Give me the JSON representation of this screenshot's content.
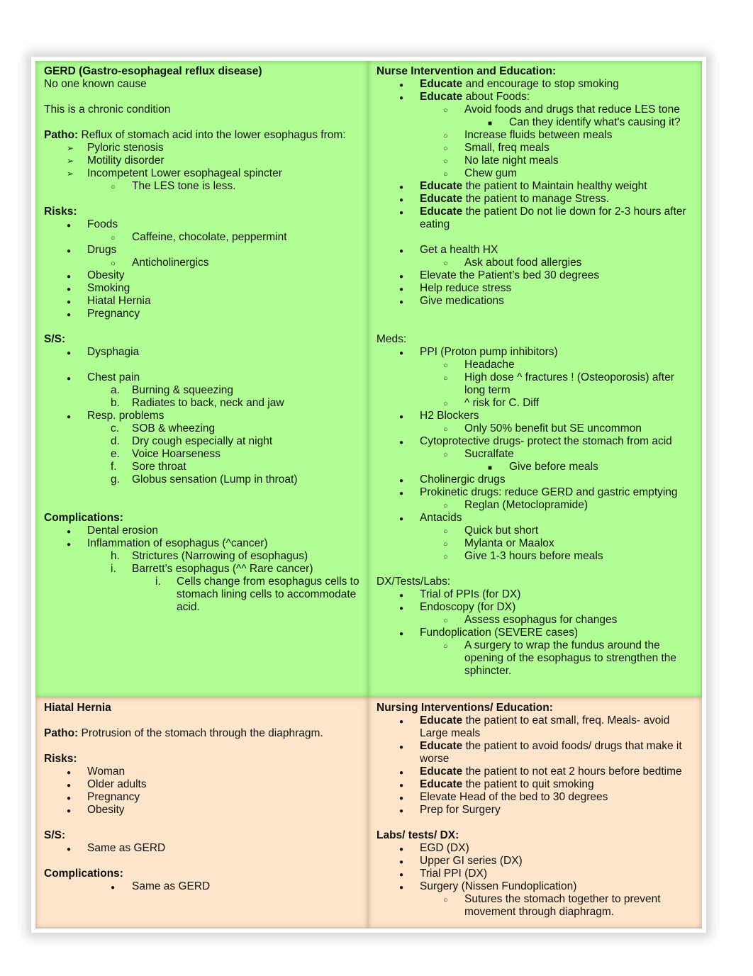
{
  "gerd": {
    "title": "GERD (Gastro-esophageal reflux disease)",
    "cause": "No one known cause",
    "chronic": "This is a chronic condition",
    "patho_label": "Patho:",
    "patho_text": " Reflux of stomach acid into the lower esophagus from:",
    "patho_items": [
      "Pyloric stenosis",
      "Motility disorder",
      "Incompetent Lower esophageal spincter"
    ],
    "patho_sub": "The LES tone is less.",
    "risks_label": "Risks:",
    "risks": {
      "foods": "Foods",
      "foods_sub": "Caffeine, chocolate, peppermint",
      "drugs": "Drugs",
      "drugs_sub": "Anticholinergics",
      "others": [
        "Obesity",
        "Smoking",
        "Hiatal Hernia",
        "Pregnancy"
      ]
    },
    "ss_label": "S/S:",
    "ss": {
      "dysphagia": "Dysphagia",
      "chest_pain": "Chest pain",
      "chest_sub": [
        {
          "marker": "a.",
          "text": "Burning & squeezing"
        },
        {
          "marker": "b.",
          "text": "Radiates to back, neck and jaw"
        }
      ],
      "resp": "Resp. problems",
      "resp_sub": [
        {
          "marker": "c.",
          "text": "SOB & wheezing"
        },
        {
          "marker": "d.",
          "text": "Dry cough especially at night"
        },
        {
          "marker": "e.",
          "text": "Voice Hoarseness"
        },
        {
          "marker": "f.",
          "text": "Sore throat"
        },
        {
          "marker": "g.",
          "text": "Globus sensation (Lump in throat)"
        }
      ]
    },
    "comp_label": "Complications:",
    "comp": {
      "items": [
        "Dental erosion",
        "Inflammation of esophagus (^cancer)"
      ],
      "sub": [
        {
          "marker": "h.",
          "text": "Strictures (Narrowing of esophagus)"
        },
        {
          "marker": "i.",
          "text": "Barrett’s esophagus (^^ Rare cancer)"
        }
      ],
      "subsub_marker": "i.",
      "subsub_text": "Cells change from esophagus cells to stomach lining cells to accommodate acid."
    }
  },
  "nurse": {
    "title": "Nurse Intervention and Education:",
    "educate": "Educate",
    "edu1": " and encourage to stop smoking",
    "edu2": " about Foods:",
    "food_sub1": "Avoid foods and drugs that reduce LES tone",
    "food_subsub": "Can they identify what's causing it?",
    "food_subs": [
      "Increase fluids between meals",
      "Small, freq meals",
      "No late night meals",
      "Chew gum"
    ],
    "edu3": " the patient to Maintain healthy weight",
    "edu4": " the patient to manage Stress.",
    "edu5": " the patient Do not lie down for 2-3 hours after eating",
    "hx": "Get a health HX",
    "hx_sub": "Ask about food allergies",
    "others": [
      "Elevate the Patient’s bed 30 degrees",
      "Help reduce stress",
      "Give medications"
    ],
    "meds_label": "Meds:",
    "ppi": "PPI (Proton pump inhibitors)",
    "ppi_sub": [
      "Headache",
      "High dose ^ fractures ! (Osteoporosis) after long term",
      "^ risk for C. Diff"
    ],
    "h2": "H2 Blockers",
    "h2_sub": "Only 50% benefit but SE uncommon",
    "cyto": "Cytoprotective drugs- protect the stomach from acid",
    "cyto_sub": "Sucralfate",
    "cyto_subsub": "Give before meals",
    "chol": "Cholinergic drugs",
    "prok": "Prokinetic drugs: reduce GERD and gastric emptying",
    "prok_sub": "Reglan (Metoclopramide)",
    "antacids": "Antacids",
    "antacids_sub": [
      "Quick but short",
      "Mylanta or Maalox",
      "Give 1-3 hours before meals"
    ],
    "dx_label": "DX/Tests/Labs:",
    "dx1": "Trial of PPIs (for DX)",
    "dx2": "Endoscopy (for DX)",
    "dx2_sub": "Assess esophagus for changes",
    "dx3": "Fundoplication (SEVERE cases)",
    "dx3_sub": "A surgery to wrap the fundus around the opening of the esophagus to strengthen the sphincter."
  },
  "hiatal": {
    "title": "Hiatal Hernia",
    "patho_label": "Patho:",
    "patho_text": " Protrusion of the stomach through the diaphragm.",
    "risks_label": "Risks:",
    "risks": [
      "Woman",
      "Older adults",
      "Pregnancy",
      "Obesity"
    ],
    "ss_label": "S/S:",
    "ss": "Same as GERD",
    "comp_label": "Complications:",
    "comp": "Same as GERD"
  },
  "hiatal_nursing": {
    "title": "Nursing Interventions/ Education:",
    "educate": "Educate",
    "edu1": " the patient to eat small, freq. Meals- avoid Large meals",
    "edu2": " the patient to avoid foods/ drugs that make it worse",
    "edu3": " the patient to not eat 2 hours before bedtime",
    "edu4": " the patient to quit smoking",
    "others": [
      "Elevate Head of the bed to 30 degrees",
      "Prep for Surgery"
    ],
    "labs_label": "Labs/ tests/ DX:",
    "labs": [
      "EGD (DX)",
      "Upper GI series (DX)",
      "Trial PPI (DX)",
      "Surgery (Nissen Fundoplication)"
    ],
    "labs_sub": "Sutures the stomach together to prevent movement through diaphragm."
  }
}
